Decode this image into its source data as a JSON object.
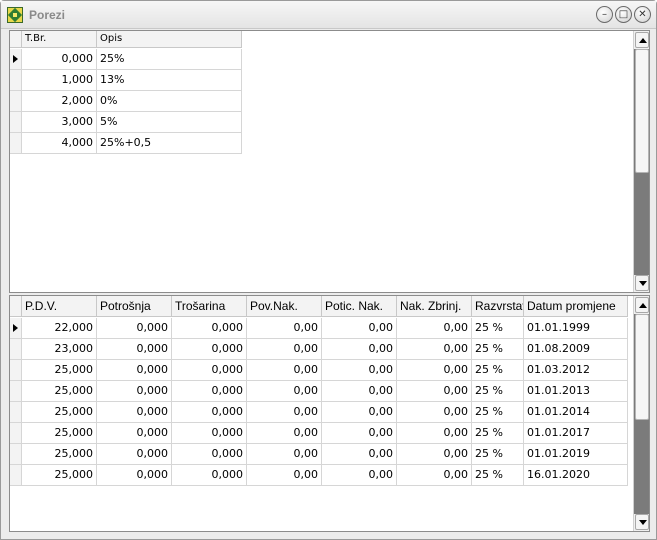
{
  "window": {
    "title": "Porezi"
  },
  "colors": {
    "grid_line": "#d6d6d6",
    "header_bg": "#f3f3f3",
    "scroll_track": "#7b7b7b"
  },
  "top_grid": {
    "columns": [
      "T.Br.",
      "Opis"
    ],
    "rows": [
      [
        "0,000",
        "25%"
      ],
      [
        "1,000",
        "13%"
      ],
      [
        "2,000",
        "0%"
      ],
      [
        "3,000",
        "5%"
      ],
      [
        "4,000",
        "25%+0,5"
      ]
    ],
    "selected_row": 0
  },
  "bottom_grid": {
    "columns": [
      "P.D.V.",
      "Potrošnja",
      "Trošarina",
      "Pov.Nak.",
      "Potic. Nak.",
      "Nak. Zbrinj.",
      "Razvrstavanje",
      "Datum promjene"
    ],
    "rows": [
      [
        "22,000",
        "0,000",
        "0,000",
        "0,00",
        "0,00",
        "0,00",
        "25 %",
        "01.01.1999"
      ],
      [
        "23,000",
        "0,000",
        "0,000",
        "0,00",
        "0,00",
        "0,00",
        "25 %",
        "01.08.2009"
      ],
      [
        "25,000",
        "0,000",
        "0,000",
        "0,00",
        "0,00",
        "0,00",
        "25 %",
        "01.03.2012"
      ],
      [
        "25,000",
        "0,000",
        "0,000",
        "0,00",
        "0,00",
        "0,00",
        "25 %",
        "01.01.2013"
      ],
      [
        "25,000",
        "0,000",
        "0,000",
        "0,00",
        "0,00",
        "0,00",
        "25 %",
        "01.01.2014"
      ],
      [
        "25,000",
        "0,000",
        "0,000",
        "0,00",
        "0,00",
        "0,00",
        "25 %",
        "01.01.2017"
      ],
      [
        "25,000",
        "0,000",
        "0,000",
        "0,00",
        "0,00",
        "0,00",
        "25 %",
        "01.01.2019"
      ],
      [
        "25,000",
        "0,000",
        "0,000",
        "0,00",
        "0,00",
        "0,00",
        "25 %",
        "16.01.2020"
      ]
    ],
    "selected_row": 0
  }
}
